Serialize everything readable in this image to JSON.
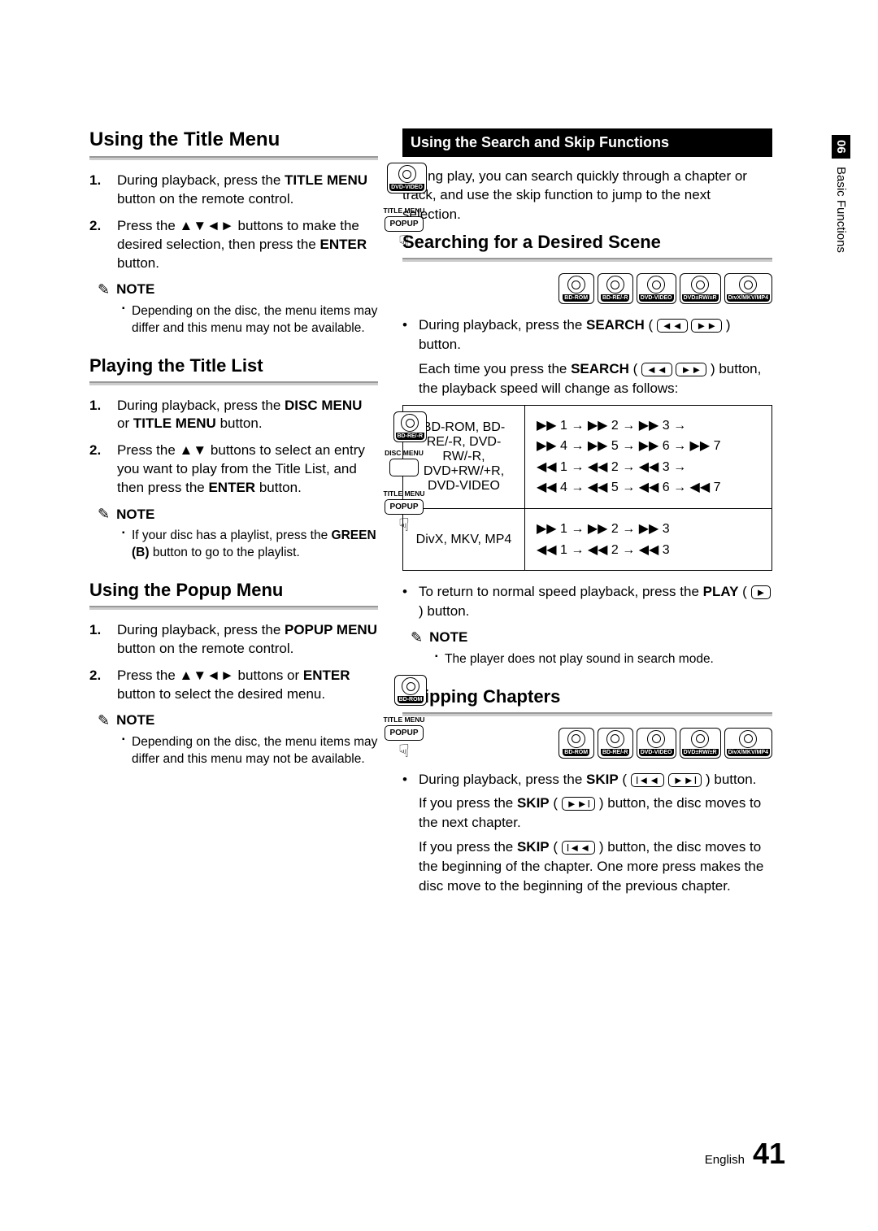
{
  "side": {
    "chapter": "06",
    "label": "Basic Functions"
  },
  "footer": {
    "lang": "English",
    "page": "41"
  },
  "left": {
    "s1": {
      "title": "Using the Title Menu",
      "disc": "DVD-VIDEO",
      "btn": "TITLE MENU",
      "pop": "POPUP",
      "step1": "During playback, press the <b>TITLE MENU</b> button on the remote control.",
      "step2": "Press the ▲▼◄► buttons to make the desired selection, then press the <b>ENTER</b> button.",
      "note": "Depending on the disc, the menu items may differ and this menu may not be available."
    },
    "s2": {
      "title": "Playing the Title List",
      "disc": "BD-RE/-R",
      "lbl1": "DISC MENU",
      "lbl2": "TITLE MENU",
      "pop": "POPUP",
      "step1": "During playback, press the <b>DISC MENU</b> or <b>TITLE MENU</b> button.",
      "step2": "Press the ▲▼ buttons to select an entry you want to play from the Title List, and then press the <b>ENTER</b> button.",
      "note": "If your disc has a playlist, press the <b>GREEN (B)</b> button to go to the playlist."
    },
    "s3": {
      "title": "Using the Popup Menu",
      "disc": "BD-ROM",
      "btn": "TITLE MENU",
      "pop": "POPUP",
      "step1": "During playback, press the <b>POPUP MENU</b> button on the remote control.",
      "step2": "Press the ▲▼◄► buttons or <b>ENTER</b> button to select the desired menu.",
      "note": "Depending on the disc, the menu items may differ and this menu may not be available."
    }
  },
  "right": {
    "bar": "Using the Search and Skip Functions",
    "intro": "During play, you can search quickly through a chapter or track, and use the skip function to jump to the next selection.",
    "search": {
      "title": "Searching for a Desired Scene",
      "formats": [
        "BD-ROM",
        "BD-RE/-R",
        "DVD-VIDEO",
        "DVD±RW/±R",
        "DivX/MKV/MP4"
      ],
      "line1": "During playback, press the <b>SEARCH</b> (",
      "line1b": ") button.",
      "line2a": "Each time you press the <b>SEARCH</b> (",
      "line2b": ") button, the playback speed will change as follows:",
      "row1lab": "BD-ROM, BD-RE/-R, DVD-RW/-R, DVD+RW/+R, DVD-VIDEO",
      "row1seq1": "▶▶ 1 → ▶▶ 2 → ▶▶ 3 →",
      "row1seq2": "▶▶ 4 → ▶▶ 5 → ▶▶ 6 → ▶▶ 7",
      "row1seq3": "◀◀ 1 → ◀◀ 2 → ◀◀ 3 →",
      "row1seq4": "◀◀ 4 → ◀◀ 5 → ◀◀ 6 → ◀◀ 7",
      "row2lab": "DivX, MKV, MP4",
      "row2seq1": "▶▶ 1 → ▶▶ 2 → ▶▶ 3",
      "row2seq2": "◀◀ 1 → ◀◀ 2 → ◀◀ 3",
      "return": "To return to normal speed playback, press the <b>PLAY</b> (",
      "returnb": ") button.",
      "note": "The player does not play sound in search mode."
    },
    "skip": {
      "title": "Skipping Chapters",
      "formats": [
        "BD-ROM",
        "BD-RE/-R",
        "DVD-VIDEO",
        "DVD±RW/±R",
        "DivX/MKV/MP4"
      ],
      "l1a": "During playback, press the <b>SKIP</b> (",
      "l1b": ") button.",
      "l2a": "If you press the <b>SKIP</b> (",
      "l2b": ") button, the disc moves to the next chapter.",
      "l3a": "If you press the <b>SKIP</b> (",
      "l3b": ") button, the disc moves to the beginning of the chapter. One more press makes the disc move to the beginning of the previous chapter."
    }
  },
  "icons": {
    "rew": "◄◄",
    "fwd": "►►",
    "prev": "I◄◄",
    "next": "►►I",
    "play": "►"
  },
  "note_label": "NOTE"
}
